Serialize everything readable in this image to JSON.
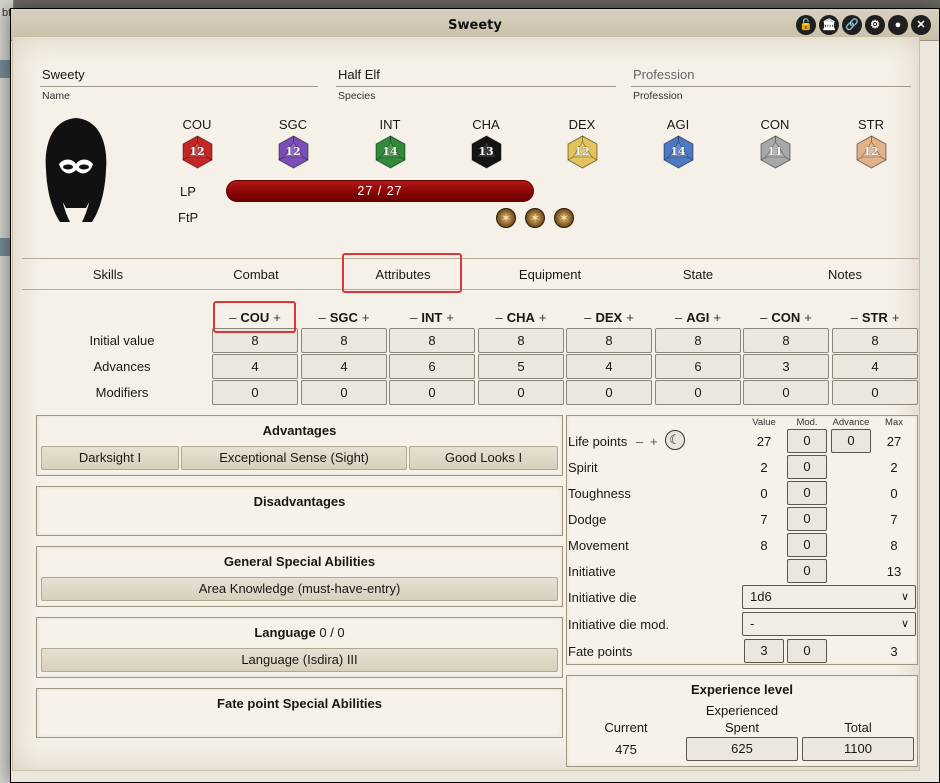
{
  "left_strip": {
    "label": "bt"
  },
  "window": {
    "title": "Sweety",
    "title_buttons": [
      "unlock-icon",
      "bank-icon",
      "link-icon",
      "gear-icon",
      "user-icon",
      "close-icon"
    ]
  },
  "identity": {
    "name_value": "Sweety",
    "name_label": "Name",
    "species_value": "Half Elf",
    "species_label": "Species",
    "profession_value": "Profession",
    "profession_label": "Profession"
  },
  "attributes": [
    {
      "abbr": "COU",
      "value": "12",
      "color": "#c62626"
    },
    {
      "abbr": "SGC",
      "value": "12",
      "color": "#7b4db8"
    },
    {
      "abbr": "INT",
      "value": "14",
      "color": "#2f8a39"
    },
    {
      "abbr": "CHA",
      "value": "13",
      "color": "#141414"
    },
    {
      "abbr": "DEX",
      "value": "12",
      "color": "#e2c35c"
    },
    {
      "abbr": "AGI",
      "value": "14",
      "color": "#4b79c4"
    },
    {
      "abbr": "CON",
      "value": "11",
      "color": "#a8a8a8"
    },
    {
      "abbr": "STR",
      "value": "12",
      "color": "#e3b286"
    }
  ],
  "vitals": {
    "lp_label": "LP",
    "lp_text": "27  /  27",
    "lp_fraction": 1.0,
    "ftp_label": "FtP",
    "fate_points_count": 3
  },
  "tabs": [
    "Skills",
    "Combat",
    "Attributes",
    "Equipment",
    "State",
    "Notes"
  ],
  "active_tab": "Attributes",
  "attr_table": {
    "headers": [
      "COU",
      "SGC",
      "INT",
      "CHA",
      "DEX",
      "AGI",
      "CON",
      "STR"
    ],
    "minus": "–",
    "plus": "+",
    "rows": [
      {
        "label": "Initial value",
        "values": [
          "8",
          "8",
          "8",
          "8",
          "8",
          "8",
          "8",
          "8"
        ]
      },
      {
        "label": "Advances",
        "values": [
          "4",
          "4",
          "6",
          "5",
          "4",
          "6",
          "3",
          "4"
        ]
      },
      {
        "label": "Modifiers",
        "values": [
          "0",
          "0",
          "0",
          "0",
          "0",
          "0",
          "0",
          "0"
        ]
      }
    ]
  },
  "advantages": {
    "title": "Advantages",
    "items": [
      "Darksight I",
      "Exceptional Sense (Sight)",
      "Good Looks I"
    ]
  },
  "disadvantages": {
    "title": "Disadvantages"
  },
  "general_sa": {
    "title": "General Special Abilities",
    "items": [
      "Area Knowledge (must-have-entry)"
    ]
  },
  "language": {
    "title": "Language",
    "count": "0 / 0",
    "items": [
      "Language (Isdira) III"
    ]
  },
  "fate_sa": {
    "title": "Fate point Special Abilities"
  },
  "stats": {
    "col_value": "Value",
    "col_mod": "Mod.",
    "col_advance": "Advance",
    "col_max": "Max",
    "life_points": {
      "label": "Life points",
      "minus": "–",
      "plus": "+",
      "value": "27",
      "mod": "0",
      "advance": "0",
      "max": "27"
    },
    "spirit": {
      "label": "Spirit",
      "value": "2",
      "mod": "0",
      "max": "2"
    },
    "toughness": {
      "label": "Toughness",
      "value": "0",
      "mod": "0",
      "max": "0"
    },
    "dodge": {
      "label": "Dodge",
      "value": "7",
      "mod": "0",
      "max": "7"
    },
    "movement": {
      "label": "Movement",
      "value": "8",
      "mod": "0",
      "max": "8"
    },
    "initiative": {
      "label": "Initiative",
      "mod": "0",
      "max": "13"
    },
    "initiative_die": {
      "label": "Initiative die",
      "selected": "1d6"
    },
    "initiative_die_mod": {
      "label": "Initiative die mod.",
      "selected": "-"
    },
    "fate_points": {
      "label": "Fate points",
      "value": "3",
      "mod": "0",
      "max": "3"
    }
  },
  "experience": {
    "title": "Experience level",
    "level": "Experienced",
    "current_label": "Current",
    "current": "475",
    "spent_label": "Spent",
    "spent": "625",
    "total_label": "Total",
    "total": "1100"
  }
}
